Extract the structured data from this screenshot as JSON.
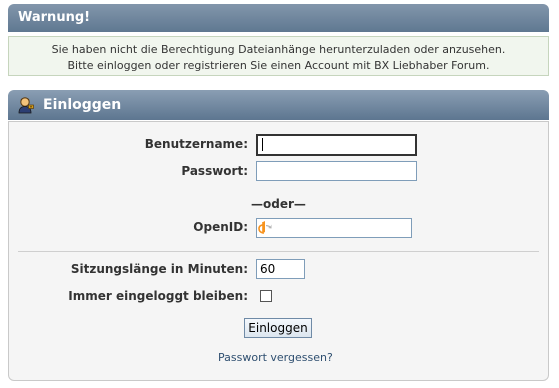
{
  "warning": {
    "title": "Warnung!",
    "line1": "Sie haben nicht die Berechtigung Dateianhänge herunterzuladen oder anzusehen.",
    "line2": "Bitte einloggen oder registrieren Sie einen Account mit BX Liebhaber Forum."
  },
  "login": {
    "title": "Einloggen",
    "icon": "user-login-icon",
    "username_label": "Benutzername:",
    "username_value": "",
    "password_label": "Passwort:",
    "password_value": "",
    "or_separator": "—oder—",
    "openid_label": "OpenID:",
    "openid_value": "",
    "openid_icon": "openid-icon",
    "session_label": "Sitzungslänge in Minuten:",
    "session_value": "60",
    "remember_label": "Immer eingeloggt bleiben:",
    "remember_checked": false,
    "submit_label": "Einloggen",
    "forgot_link": "Passwort vergessen?"
  },
  "colors": {
    "header_bg": "#6a8299",
    "warning_bg": "#f1f6ee",
    "panel_bg": "#f5f5f5",
    "link": "#2f4f70"
  }
}
